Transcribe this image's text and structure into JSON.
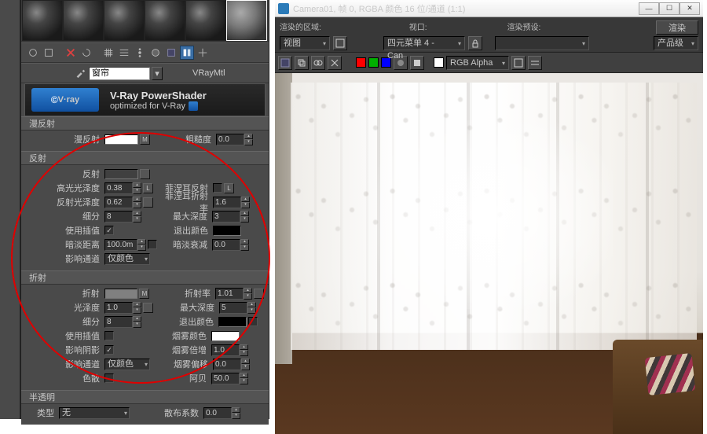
{
  "material_editor": {
    "material_name": "窗帘",
    "material_type": "VRayMtl",
    "banner": {
      "title": "V-Ray PowerShader",
      "subtitle": "optimized for V-Ray",
      "logo_text": "V·ray"
    },
    "diffuse": {
      "section": "漫反射",
      "label": "漫反射",
      "color": "#ffffff",
      "map": "M",
      "roughness_label": "粗糙度",
      "roughness": "0.0"
    },
    "reflection": {
      "section": "反射",
      "label": "反射",
      "color": "#404040",
      "hilight_label": "高光光泽度",
      "hilight": "0.38",
      "hilight_lock": "L",
      "refl_gloss_label": "反射光泽度",
      "refl_gloss": "0.62",
      "refl_lock": "L",
      "subdiv_label": "细分",
      "subdiv": "8",
      "interp_label": "使用插值",
      "interp": true,
      "dim_dist_label": "暗淡距离",
      "dim_dist": "100.0m",
      "channels_label": "影响通道",
      "channels": "仅颜色",
      "fresnel_label": "菲涅耳反射",
      "fresnel": false,
      "fresnel_ior_label": "菲涅耳折射率",
      "fresnel_ior": "1.6",
      "max_depth_label": "最大深度",
      "max_depth": "3",
      "exit_color_label": "退出颜色",
      "exit_color": "#000000",
      "dim_falloff_label": "暗淡衰减",
      "dim_falloff": "0.0"
    },
    "refraction": {
      "section": "折射",
      "label": "折射",
      "color": "#808080",
      "map": "M",
      "gloss_label": "光泽度",
      "gloss": "1.0",
      "subdiv_label": "细分",
      "subdiv": "8",
      "interp_label": "使用插值",
      "interp": false,
      "shadows_label": "影响阴影",
      "shadows": true,
      "channels_label": "影响通道",
      "channels": "仅颜色",
      "ior_label": "折射率",
      "ior": "1.01",
      "max_depth_label": "最大深度",
      "max_depth": "5",
      "exit_color_label": "退出颜色",
      "exit_color": "#000000",
      "fog_color_label": "烟雾颜色",
      "fog_color": "#ffffff",
      "fog_mult_label": "烟雾倍增",
      "fog_mult": "1.0",
      "fog_bias_label": "烟雾偏移",
      "fog_bias": "0.0",
      "dispersion_label": "色散",
      "dispersion": false,
      "abbe_label": "阿贝",
      "abbe": "50.0"
    },
    "translucency": {
      "section": "半透明",
      "type_label": "类型",
      "type": "无",
      "scatter_label": "散布系数",
      "scatter": "0.0"
    }
  },
  "render_window": {
    "title": "Camera01, 帧 0, RGBA 颜色 16 位/通道 (1:1)",
    "area_label": "渲染的区域:",
    "area_value": "视图",
    "viewport_label": "视口:",
    "viewport_value": "四元菜单 4 - Can",
    "preset_label": "渲染预设:",
    "preset_value": "",
    "render_btn": "渲染",
    "output_label": "产品级",
    "channel": "RGB Alpha",
    "channel_colors": [
      "#ff0000",
      "#00b000",
      "#0000ff"
    ]
  }
}
